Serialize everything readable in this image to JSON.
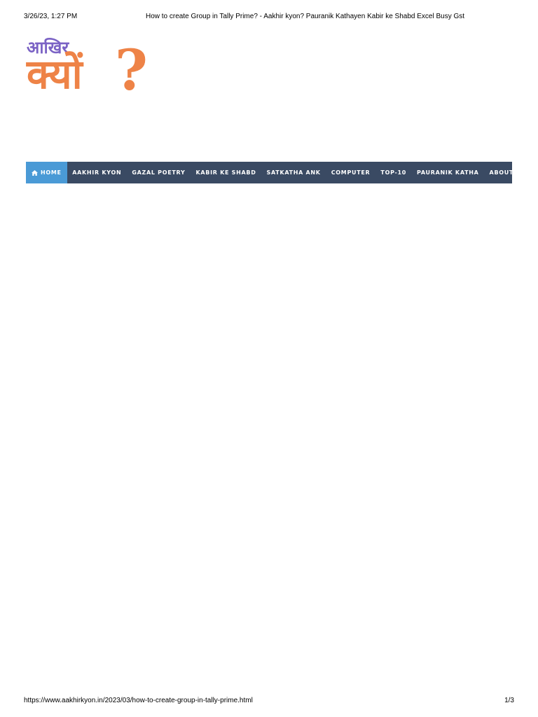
{
  "print_header": {
    "datetime": "3/26/23, 1:27 PM",
    "title": "How to create Group in Tally Prime? - Aakhir kyon? Pauranik Kathayen Kabir ke Shabd Excel Busy Gst"
  },
  "logo": {
    "top_text": "आखिर",
    "main_text": "क्यों",
    "question_mark": "?",
    "colors": {
      "top": "#7b63c5",
      "main": "#ee8347"
    }
  },
  "nav": {
    "background": "#3a4a63",
    "active_background": "#4a9ad6",
    "home_icon": "home-icon",
    "items": [
      {
        "label": "HOME",
        "active": true
      },
      {
        "label": "AAKHIR KYON",
        "active": false
      },
      {
        "label": "GAZAL POETRY",
        "active": false
      },
      {
        "label": "KABIR KE SHABD",
        "active": false
      },
      {
        "label": "SATKATHA ANK",
        "active": false
      },
      {
        "label": "COMPUTER",
        "active": false
      },
      {
        "label": "TOP-10",
        "active": false
      },
      {
        "label": "PAURANIK KATHA",
        "active": false
      },
      {
        "label": "ABOUT US",
        "active": false
      }
    ]
  },
  "print_footer": {
    "url": "https://www.aakhirkyon.in/2023/03/how-to-create-group-in-tally-prime.html",
    "page": "1/3"
  }
}
